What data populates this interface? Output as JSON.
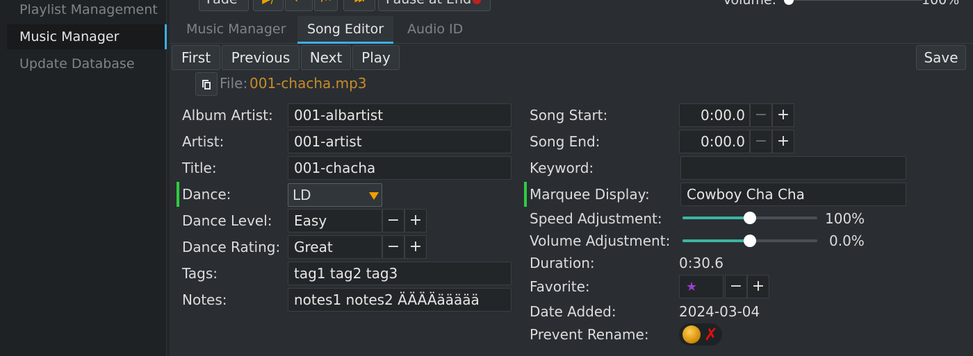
{
  "sidebar": {
    "items": [
      {
        "label": "Playlist Management"
      },
      {
        "label": "Music Manager"
      },
      {
        "label": "Update Database"
      }
    ]
  },
  "topbar": {
    "fade_label": "Fade",
    "pause_at_end_label": "Pause at End",
    "volume_label": "Volume:",
    "volume_value": "100%"
  },
  "tabs": [
    {
      "label": "Music Manager"
    },
    {
      "label": "Song Editor"
    },
    {
      "label": "Audio ID"
    }
  ],
  "nav": {
    "first": "First",
    "previous": "Previous",
    "next": "Next",
    "play": "Play",
    "save": "Save"
  },
  "file": {
    "label": "File:",
    "name": "001-chacha.mp3"
  },
  "left_fields": {
    "album_artist": {
      "label": "Album Artist:",
      "value": "001-albartist"
    },
    "artist": {
      "label": "Artist:",
      "value": "001-artist"
    },
    "title": {
      "label": "Title:",
      "value": "001-chacha"
    },
    "dance": {
      "label": "Dance:",
      "value": "LD"
    },
    "dance_level": {
      "label": "Dance Level:",
      "value": "Easy"
    },
    "dance_rating": {
      "label": "Dance Rating:",
      "value": "Great"
    },
    "tags": {
      "label": "Tags:",
      "value": "tag1 tag2 tag3"
    },
    "notes": {
      "label": "Notes:",
      "value": "notes1 notes2 ÄÄÄÄäääää"
    }
  },
  "right_fields": {
    "song_start": {
      "label": "Song Start:",
      "value": "0:00.0"
    },
    "song_end": {
      "label": "Song End:",
      "value": "0:00.0"
    },
    "keyword": {
      "label": "Keyword:",
      "value": ""
    },
    "marquee_display": {
      "label": "Marquee Display:",
      "value": "Cowboy Cha Cha"
    },
    "speed_adjustment": {
      "label": "Speed Adjustment:",
      "value": "100%",
      "fraction": 0.5
    },
    "volume_adjustment": {
      "label": "Volume Adjustment:",
      "value": "0.0%",
      "fraction": 0.5
    },
    "duration": {
      "label": "Duration:",
      "value": "0:30.6"
    },
    "favorite": {
      "label": "Favorite:",
      "star": "★"
    },
    "date_added": {
      "label": "Date Added:",
      "value": "2024-03-04"
    },
    "prevent_rename": {
      "label": "Prevent Rename:"
    }
  },
  "stepper": {
    "minus": "−",
    "plus": "+"
  },
  "icons": {
    "playpause": "▶/❚❚",
    "repeat": "↩",
    "prev": "⏮",
    "next": "⏭"
  },
  "colors": {
    "accent": "#3daee9",
    "file_name": "#c98b2a",
    "changed_marker": "#2ecc40",
    "favorite_star": "#9b3fd0"
  }
}
